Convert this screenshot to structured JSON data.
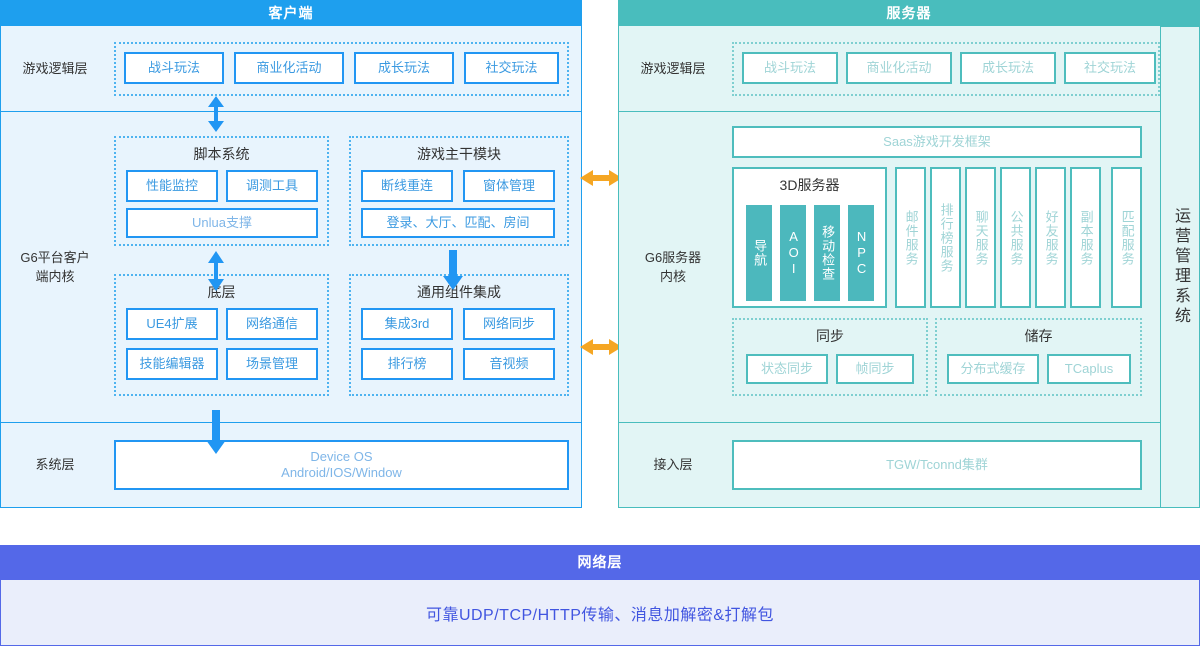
{
  "client": {
    "title": "客户端",
    "rows": [
      {
        "label": "游戏逻辑层"
      },
      {
        "label": "G6平台客户\n端内核"
      },
      {
        "label": "系统层"
      }
    ],
    "logic_items": [
      "战斗玩法",
      "商业化活动",
      "成长玩法",
      "社交玩法"
    ],
    "script_system": {
      "title": "脚本系统",
      "items": [
        "性能监控",
        "调测工具"
      ],
      "wide_item": "Unlua支撑"
    },
    "game_trunk": {
      "title": "游戏主干模块",
      "items": [
        "断线重连",
        "窗体管理"
      ],
      "wide_item": "登录、大厅、匹配、房间"
    },
    "bottom_layer": {
      "title": "底层",
      "items": [
        "UE4扩展",
        "网络通信",
        "技能编辑器",
        "场景管理"
      ]
    },
    "common_components": {
      "title": "通用组件集成",
      "items": [
        "集成3rd",
        "网络同步",
        "排行榜",
        "音视频"
      ]
    },
    "system_layer": {
      "line1": "Device OS",
      "line2": "Android/IOS/Window"
    }
  },
  "server": {
    "title": "服务器",
    "rows": [
      {
        "label": "游戏逻辑层"
      },
      {
        "label": "G6服务器\n内核"
      },
      {
        "label": "接入层"
      }
    ],
    "logic_items": [
      "战斗玩法",
      "商业化活动",
      "成长玩法",
      "社交玩法"
    ],
    "saas_framework": "Saas游戏开发框架",
    "server_3d": {
      "title": "3D服务器",
      "items": [
        "导航",
        "AOI",
        "移动检查",
        "NPC"
      ]
    },
    "services": [
      "邮件服务",
      "排行榜服务",
      "聊天服务",
      "公共服务",
      "好友服务",
      "副本服务",
      "匹配服务"
    ],
    "sync": {
      "title": "同步",
      "items": [
        "状态同步",
        "帧同步"
      ]
    },
    "storage": {
      "title": "储存",
      "items": [
        "分布式缓存",
        "TCaplus"
      ]
    },
    "access_layer": "TGW/Tconnd集群"
  },
  "ops_system": {
    "label": "运营管理系统"
  },
  "network": {
    "title": "网络层",
    "description": "可靠UDP/TCP/HTTP传输、消息加解密&打解包"
  },
  "colors": {
    "client_accent": "#1e9fee",
    "client_bg": "#e8f4fd",
    "server_accent": "#49bdbd",
    "server_bg": "#e2f5f5",
    "network_accent": "#5468e8",
    "network_bg": "#eaeefb",
    "arrow_orange": "#f5a623",
    "arrow_blue": "#2196f3",
    "teal_fill": "#4cb8bd"
  }
}
